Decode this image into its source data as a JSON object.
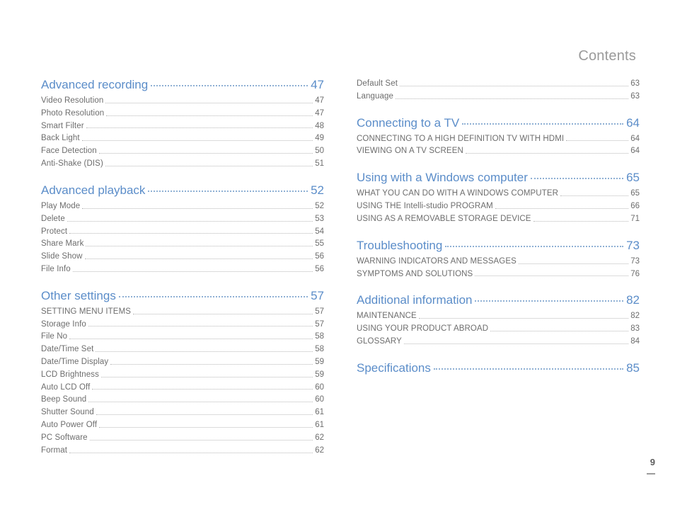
{
  "header": {
    "title": "Contents"
  },
  "page_number": "9",
  "columns": [
    {
      "sections": [
        {
          "title": "Advanced recording",
          "page": "47",
          "entries": [
            {
              "title": "Video Resolution",
              "page": "47"
            },
            {
              "title": "Photo Resolution",
              "page": "47"
            },
            {
              "title": "Smart Filter",
              "page": "48"
            },
            {
              "title": "Back Light",
              "page": "49"
            },
            {
              "title": "Face Detection",
              "page": "50"
            },
            {
              "title": "Anti-Shake (DIS)",
              "page": "51"
            }
          ]
        },
        {
          "title": "Advanced playback",
          "page": "52",
          "entries": [
            {
              "title": "Play Mode",
              "page": "52"
            },
            {
              "title": "Delete",
              "page": "53"
            },
            {
              "title": "Protect",
              "page": "54"
            },
            {
              "title": "Share Mark",
              "page": "55"
            },
            {
              "title": "Slide Show",
              "page": "56"
            },
            {
              "title": "File Info",
              "page": "56"
            }
          ]
        },
        {
          "title": "Other settings",
          "page": "57",
          "entries": [
            {
              "title": "SETTING MENU ITEMS",
              "page": "57"
            },
            {
              "title": "Storage Info",
              "page": "57"
            },
            {
              "title": "File No",
              "page": "58"
            },
            {
              "title": "Date/Time Set",
              "page": "58"
            },
            {
              "title": "Date/Time Display",
              "page": "59"
            },
            {
              "title": "LCD Brightness",
              "page": "59"
            },
            {
              "title": "Auto LCD Off",
              "page": "60"
            },
            {
              "title": "Beep Sound",
              "page": "60"
            },
            {
              "title": "Shutter Sound",
              "page": "61"
            },
            {
              "title": "Auto Power Off",
              "page": "61"
            },
            {
              "title": "PC Software",
              "page": "62"
            },
            {
              "title": "Format",
              "page": "62"
            }
          ]
        }
      ]
    },
    {
      "sections": [
        {
          "entries_only": true,
          "entries": [
            {
              "title": "Default Set",
              "page": "63"
            },
            {
              "title": "Language",
              "page": "63"
            }
          ]
        },
        {
          "title": "Connecting to a TV",
          "page": "64",
          "entries": [
            {
              "title": "CONNECTING TO A HIGH DEFINITION TV WITH HDMI",
              "page": "64"
            },
            {
              "title": "VIEWING ON A TV SCREEN",
              "page": "64"
            }
          ]
        },
        {
          "title": "Using with a Windows computer",
          "page": "65",
          "entries": [
            {
              "title": "WHAT YOU CAN DO WITH A WINDOWS COMPUTER",
              "page": "65"
            },
            {
              "title": "USING THE Intelli-studio PROGRAM",
              "page": "66"
            },
            {
              "title": "USING AS A REMOVABLE STORAGE DEVICE",
              "page": "71"
            }
          ]
        },
        {
          "title": "Troubleshooting",
          "page": "73",
          "entries": [
            {
              "title": "WARNING INDICATORS AND MESSAGES",
              "page": "73"
            },
            {
              "title": "SYMPTOMS AND SOLUTIONS",
              "page": "76"
            }
          ]
        },
        {
          "title": "Additional information",
          "page": "82",
          "entries": [
            {
              "title": "MAINTENANCE",
              "page": "82"
            },
            {
              "title": "USING YOUR PRODUCT ABROAD",
              "page": "83"
            },
            {
              "title": "GLOSSARY",
              "page": "84"
            }
          ]
        },
        {
          "title": "Specifications",
          "page": "85",
          "entries": []
        }
      ]
    }
  ]
}
